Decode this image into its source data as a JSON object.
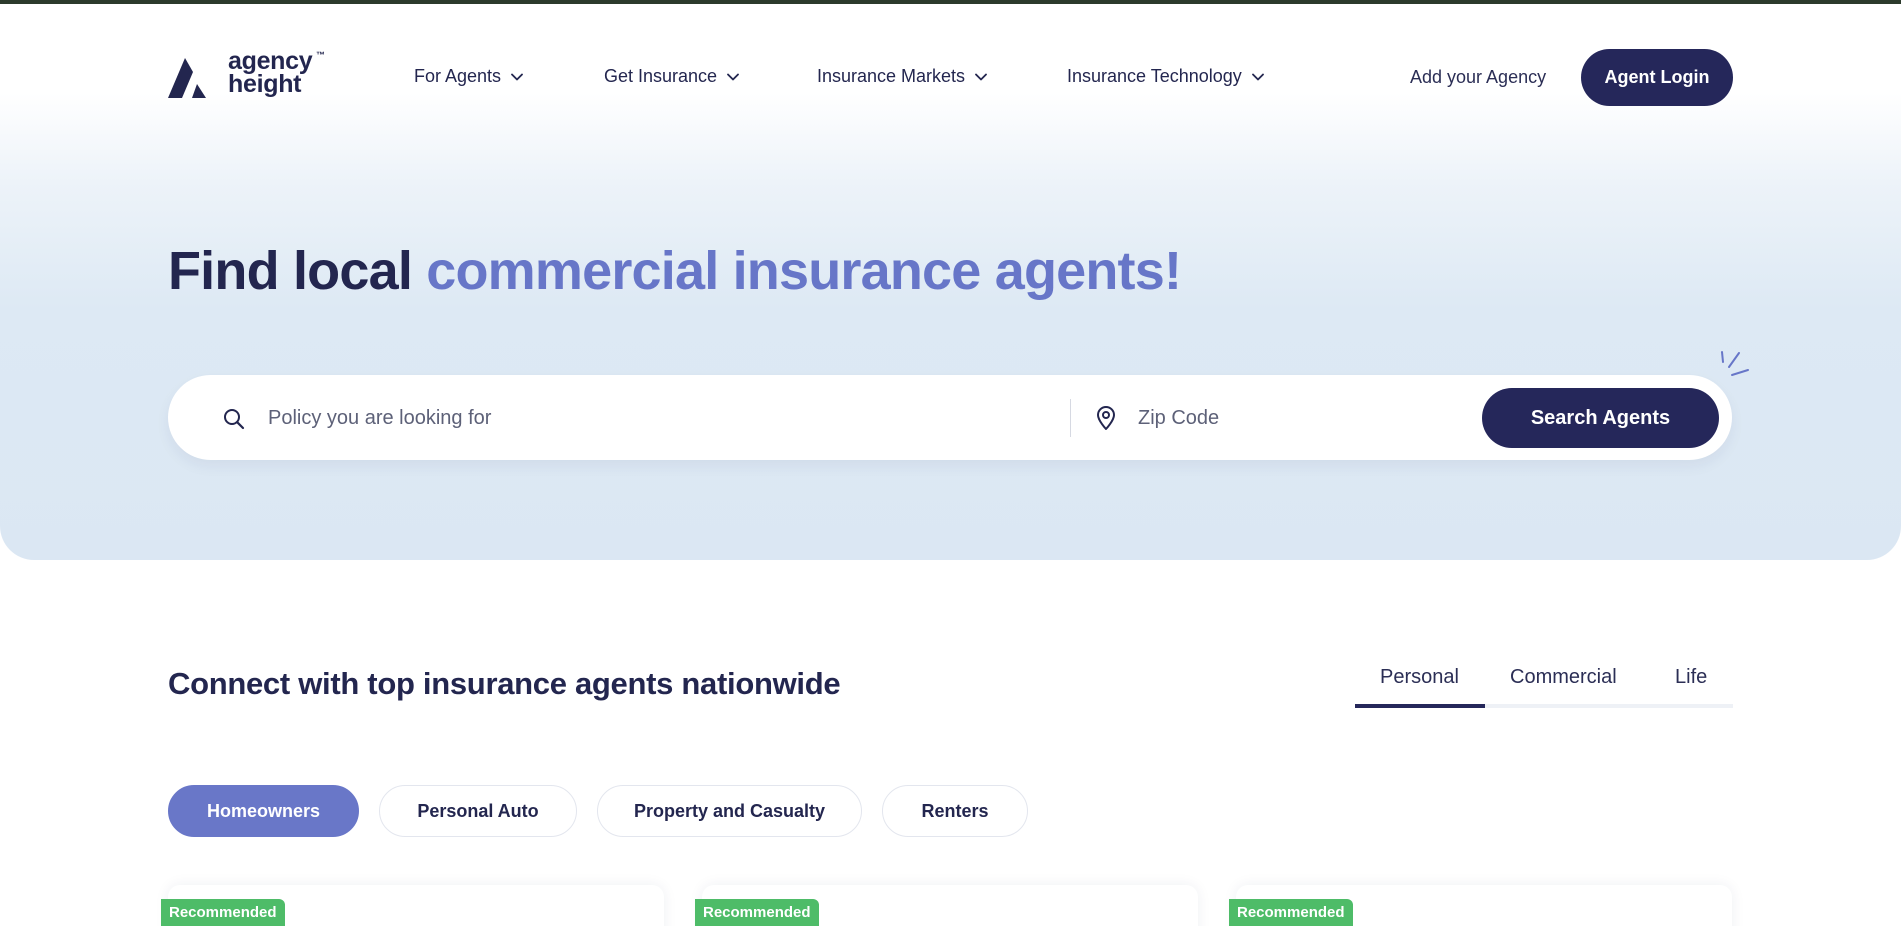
{
  "header": {
    "logo": {
      "line1": "agency",
      "line2": "height",
      "tm": "™"
    },
    "nav": [
      {
        "label": "For Agents"
      },
      {
        "label": "Get Insurance"
      },
      {
        "label": "Insurance Markets"
      },
      {
        "label": "Insurance Technology"
      }
    ],
    "add_agency": "Add your Agency",
    "login": "Agent Login"
  },
  "hero": {
    "title_dark": "Find local",
    "title_accent": "commercial insurance agents!",
    "search": {
      "policy_placeholder": "Policy you are looking for",
      "zip_placeholder": "Zip Code",
      "button": "Search Agents"
    }
  },
  "connect": {
    "title": "Connect with top insurance agents nationwide",
    "tabs": [
      {
        "label": "Personal",
        "active": true
      },
      {
        "label": "Commercial",
        "active": false
      },
      {
        "label": "Life",
        "active": false
      }
    ],
    "pills": [
      {
        "label": "Homeowners",
        "active": true
      },
      {
        "label": "Personal Auto",
        "active": false
      },
      {
        "label": "Property and Casualty",
        "active": false
      },
      {
        "label": "Renters",
        "active": false
      }
    ],
    "cards": [
      {
        "badge": "Recommended"
      },
      {
        "badge": "Recommended"
      },
      {
        "badge": "Recommended"
      }
    ]
  },
  "colors": {
    "navy": "#25275a",
    "accent": "#6776c8",
    "pill_active": "#6977c8",
    "badge_green": "#4ebc68",
    "hero_bg": "#dbe7f3"
  },
  "icons": [
    "logo-mark-icon",
    "chevron-down-icon",
    "search-icon",
    "location-pin-icon",
    "sparkle-icon"
  ]
}
